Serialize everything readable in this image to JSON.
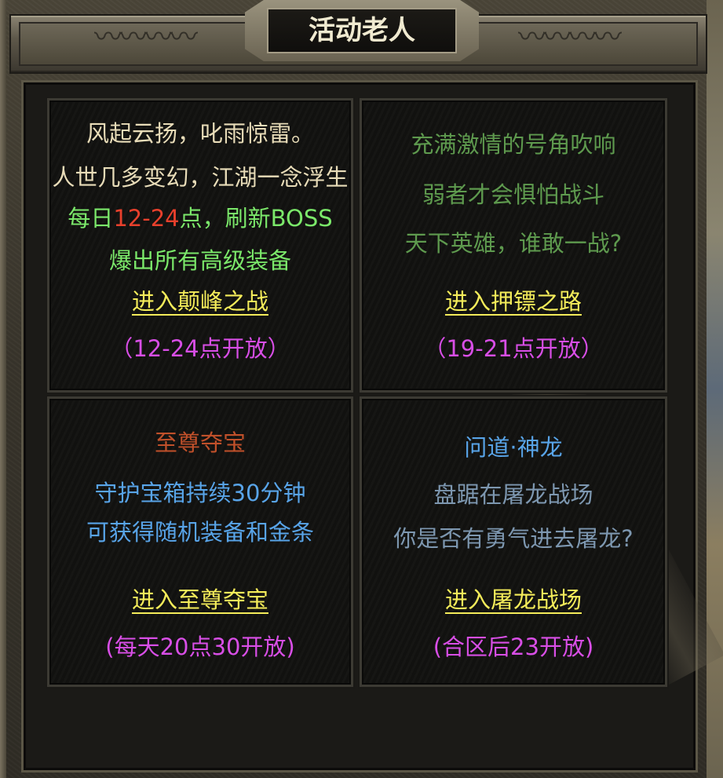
{
  "title": "活动老人",
  "panels": {
    "peak": {
      "lines": [
        "风起云扬，叱雨惊雷。",
        "人世几多变幻，江湖一念浮生"
      ],
      "daily_prefix": "每日",
      "daily_time": "12-24",
      "daily_suffix": "点，刷新BOSS",
      "drop_line": "爆出所有高级装备",
      "link": "进入颠峰之战",
      "open_time": "（12-24点开放）"
    },
    "escort": {
      "lines": [
        "充满激情的号角吹响",
        "弱者才会惧怕战斗",
        "天下英雄，谁敢一战?"
      ],
      "link": "进入押镖之路",
      "open_time": "（19-21点开放）"
    },
    "treasure": {
      "heading": "至尊夺宝",
      "lines": [
        "守护宝箱持续30分钟",
        "可获得随机装备和金条"
      ],
      "link": "进入至尊夺宝",
      "open_time": "(每天20点30开放)"
    },
    "dragon": {
      "heading": "问道·神龙",
      "lines": [
        "盘踞在屠龙战场",
        "你是否有勇气进去屠龙?"
      ],
      "link": "进入屠龙战场",
      "open_time": "(合区后23开放)"
    }
  },
  "colors": {
    "cream": "#e8dcb8",
    "green_bright": "#7be86a",
    "red": "#e8402c",
    "green_muted": "#5e9a4e",
    "yellow_link": "#f4ec5a",
    "magenta": "#d84ee6",
    "rust": "#c0502a",
    "blue": "#58a4e8",
    "steel": "#7d97b0"
  }
}
